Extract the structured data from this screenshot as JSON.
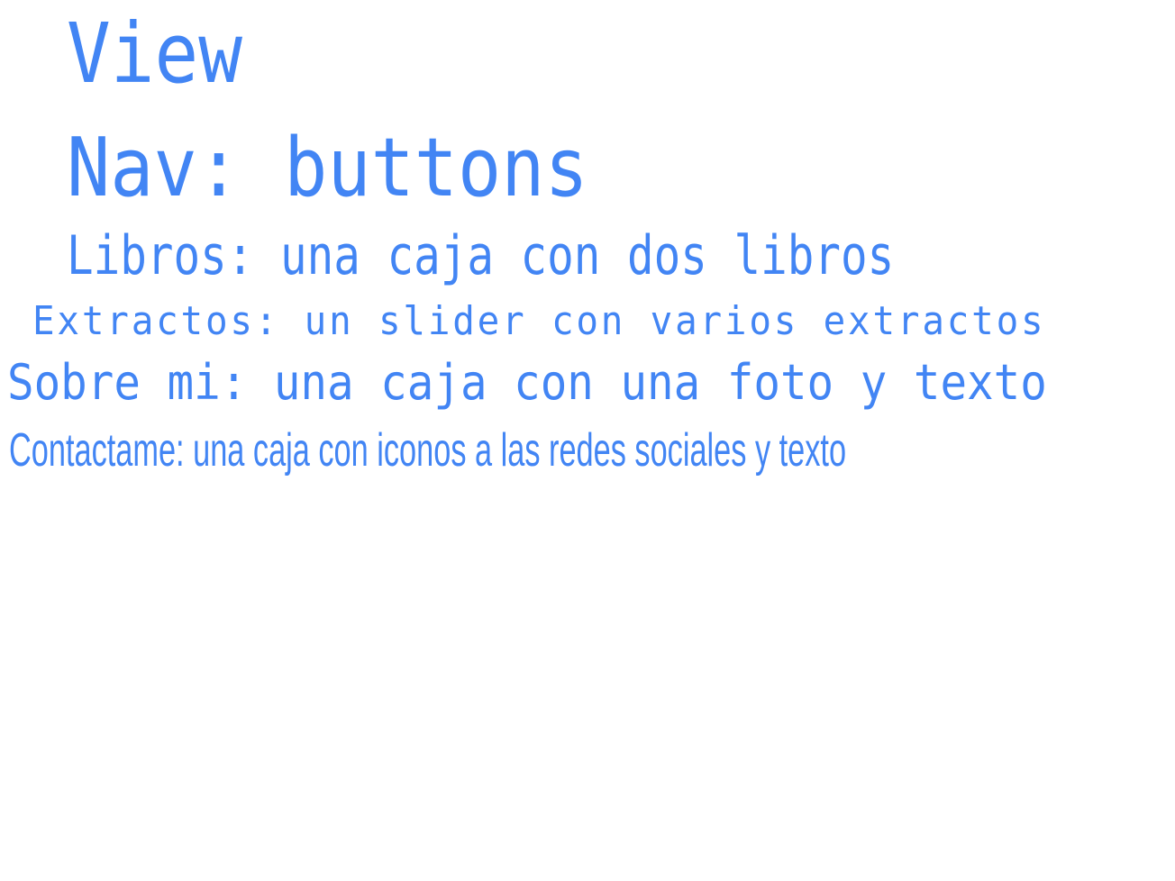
{
  "page": {
    "title": "View",
    "text_color": "#4285f4",
    "background": "#ffffff"
  },
  "sections": {
    "nav": "Nav: buttons",
    "libros": "Libros: una caja con dos libros",
    "extractos": "Extractos: un slider con varios extractos",
    "sobre_mi": "Sobre mi: una caja con una foto y texto",
    "contactame": "Contactame: una caja con iconos a las redes sociales y texto"
  }
}
